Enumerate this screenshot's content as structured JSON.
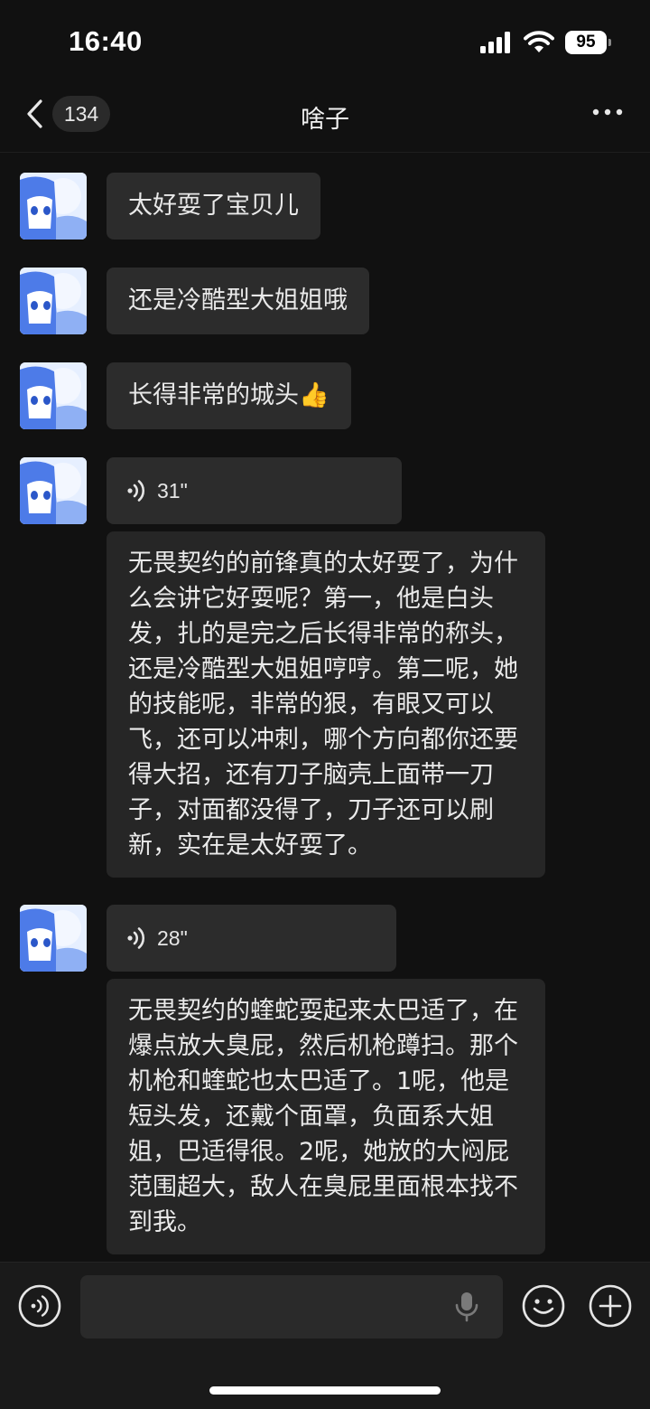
{
  "status_bar": {
    "time": "16:40",
    "battery": "95"
  },
  "nav": {
    "back_count": "134",
    "title": "啥子"
  },
  "messages": [
    {
      "type": "text",
      "text": "太好耍了宝贝儿"
    },
    {
      "type": "text",
      "text": "还是冷酷型大姐姐哦"
    },
    {
      "type": "text",
      "text": "长得非常的城头👍"
    },
    {
      "type": "voice",
      "duration": "31\"",
      "transcript": "无畏契约的前锋真的太好耍了，为什么会讲它好耍呢？第一，他是白头发，扎的是完之后长得非常的称头，还是冷酷型大姐姐哼哼。第二呢，她的技能呢，非常的狠，有眼又可以飞，还可以冲刺，哪个方向都你还要得大招，还有刀子脑壳上面带一刀子，对面都没得了，刀子还可以刷新，实在是太好耍了。"
    },
    {
      "type": "voice",
      "duration": "28\"",
      "transcript": "无畏契约的蝰蛇耍起来太巴适了，在爆点放大臭屁，然后机枪蹲扫。那个机枪和蝰蛇也太巴适了。1呢，他是短头发，还戴个面罩，负面系大姐姐，巴适得很。2呢，她放的大闷屁范围超大，敌人在臭屁里面根本找不到我。"
    }
  ],
  "input_bar": {
    "placeholder": ""
  },
  "icons": {
    "back": "chevron-left-icon",
    "more": "more-icon",
    "voice": "voice-icon",
    "mic": "mic-icon",
    "emoji": "emoji-icon",
    "add": "plus-icon"
  },
  "colors": {
    "background": "#111111",
    "bubble": "#2c2c2c",
    "transcript_bubble": "#262626"
  }
}
